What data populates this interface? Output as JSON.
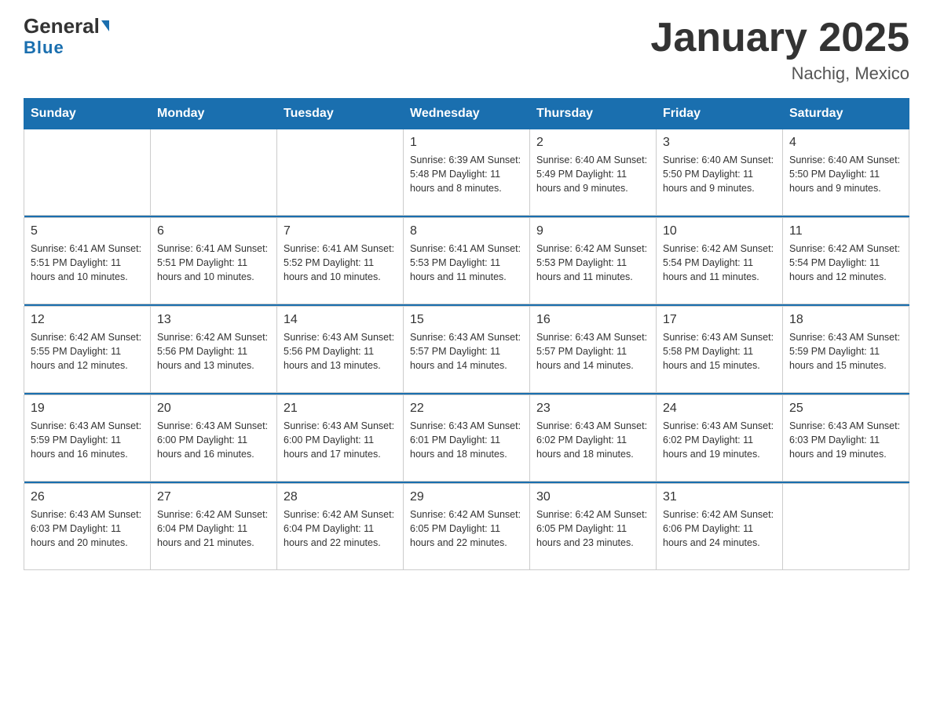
{
  "header": {
    "logo_general": "General",
    "logo_blue": "Blue",
    "title": "January 2025",
    "subtitle": "Nachig, Mexico"
  },
  "days_of_week": [
    "Sunday",
    "Monday",
    "Tuesday",
    "Wednesday",
    "Thursday",
    "Friday",
    "Saturday"
  ],
  "weeks": [
    [
      {
        "day": "",
        "info": ""
      },
      {
        "day": "",
        "info": ""
      },
      {
        "day": "",
        "info": ""
      },
      {
        "day": "1",
        "info": "Sunrise: 6:39 AM\nSunset: 5:48 PM\nDaylight: 11 hours and 8 minutes."
      },
      {
        "day": "2",
        "info": "Sunrise: 6:40 AM\nSunset: 5:49 PM\nDaylight: 11 hours and 9 minutes."
      },
      {
        "day": "3",
        "info": "Sunrise: 6:40 AM\nSunset: 5:50 PM\nDaylight: 11 hours and 9 minutes."
      },
      {
        "day": "4",
        "info": "Sunrise: 6:40 AM\nSunset: 5:50 PM\nDaylight: 11 hours and 9 minutes."
      }
    ],
    [
      {
        "day": "5",
        "info": "Sunrise: 6:41 AM\nSunset: 5:51 PM\nDaylight: 11 hours and 10 minutes."
      },
      {
        "day": "6",
        "info": "Sunrise: 6:41 AM\nSunset: 5:51 PM\nDaylight: 11 hours and 10 minutes."
      },
      {
        "day": "7",
        "info": "Sunrise: 6:41 AM\nSunset: 5:52 PM\nDaylight: 11 hours and 10 minutes."
      },
      {
        "day": "8",
        "info": "Sunrise: 6:41 AM\nSunset: 5:53 PM\nDaylight: 11 hours and 11 minutes."
      },
      {
        "day": "9",
        "info": "Sunrise: 6:42 AM\nSunset: 5:53 PM\nDaylight: 11 hours and 11 minutes."
      },
      {
        "day": "10",
        "info": "Sunrise: 6:42 AM\nSunset: 5:54 PM\nDaylight: 11 hours and 11 minutes."
      },
      {
        "day": "11",
        "info": "Sunrise: 6:42 AM\nSunset: 5:54 PM\nDaylight: 11 hours and 12 minutes."
      }
    ],
    [
      {
        "day": "12",
        "info": "Sunrise: 6:42 AM\nSunset: 5:55 PM\nDaylight: 11 hours and 12 minutes."
      },
      {
        "day": "13",
        "info": "Sunrise: 6:42 AM\nSunset: 5:56 PM\nDaylight: 11 hours and 13 minutes."
      },
      {
        "day": "14",
        "info": "Sunrise: 6:43 AM\nSunset: 5:56 PM\nDaylight: 11 hours and 13 minutes."
      },
      {
        "day": "15",
        "info": "Sunrise: 6:43 AM\nSunset: 5:57 PM\nDaylight: 11 hours and 14 minutes."
      },
      {
        "day": "16",
        "info": "Sunrise: 6:43 AM\nSunset: 5:57 PM\nDaylight: 11 hours and 14 minutes."
      },
      {
        "day": "17",
        "info": "Sunrise: 6:43 AM\nSunset: 5:58 PM\nDaylight: 11 hours and 15 minutes."
      },
      {
        "day": "18",
        "info": "Sunrise: 6:43 AM\nSunset: 5:59 PM\nDaylight: 11 hours and 15 minutes."
      }
    ],
    [
      {
        "day": "19",
        "info": "Sunrise: 6:43 AM\nSunset: 5:59 PM\nDaylight: 11 hours and 16 minutes."
      },
      {
        "day": "20",
        "info": "Sunrise: 6:43 AM\nSunset: 6:00 PM\nDaylight: 11 hours and 16 minutes."
      },
      {
        "day": "21",
        "info": "Sunrise: 6:43 AM\nSunset: 6:00 PM\nDaylight: 11 hours and 17 minutes."
      },
      {
        "day": "22",
        "info": "Sunrise: 6:43 AM\nSunset: 6:01 PM\nDaylight: 11 hours and 18 minutes."
      },
      {
        "day": "23",
        "info": "Sunrise: 6:43 AM\nSunset: 6:02 PM\nDaylight: 11 hours and 18 minutes."
      },
      {
        "day": "24",
        "info": "Sunrise: 6:43 AM\nSunset: 6:02 PM\nDaylight: 11 hours and 19 minutes."
      },
      {
        "day": "25",
        "info": "Sunrise: 6:43 AM\nSunset: 6:03 PM\nDaylight: 11 hours and 19 minutes."
      }
    ],
    [
      {
        "day": "26",
        "info": "Sunrise: 6:43 AM\nSunset: 6:03 PM\nDaylight: 11 hours and 20 minutes."
      },
      {
        "day": "27",
        "info": "Sunrise: 6:42 AM\nSunset: 6:04 PM\nDaylight: 11 hours and 21 minutes."
      },
      {
        "day": "28",
        "info": "Sunrise: 6:42 AM\nSunset: 6:04 PM\nDaylight: 11 hours and 22 minutes."
      },
      {
        "day": "29",
        "info": "Sunrise: 6:42 AM\nSunset: 6:05 PM\nDaylight: 11 hours and 22 minutes."
      },
      {
        "day": "30",
        "info": "Sunrise: 6:42 AM\nSunset: 6:05 PM\nDaylight: 11 hours and 23 minutes."
      },
      {
        "day": "31",
        "info": "Sunrise: 6:42 AM\nSunset: 6:06 PM\nDaylight: 11 hours and 24 minutes."
      },
      {
        "day": "",
        "info": ""
      }
    ]
  ]
}
